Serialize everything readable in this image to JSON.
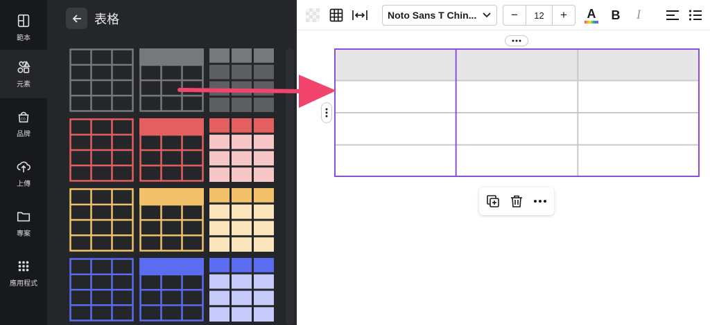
{
  "rail": {
    "items": [
      {
        "label": "範本",
        "icon": "template-icon"
      },
      {
        "label": "元素",
        "icon": "elements-icon"
      },
      {
        "label": "品牌",
        "icon": "brand-icon"
      },
      {
        "label": "上傳",
        "icon": "upload-icon"
      },
      {
        "label": "專案",
        "icon": "folder-icon"
      },
      {
        "label": "應用程式",
        "icon": "apps-icon"
      }
    ],
    "active": "元素"
  },
  "panel": {
    "title": "表格",
    "back_icon": "arrow-left-icon",
    "styles": [
      {
        "name": "gray",
        "color": "#77787c",
        "light": "#5e5f63"
      },
      {
        "name": "red",
        "color": "#e45f5f",
        "light": "#f7c6c6"
      },
      {
        "name": "yellow",
        "color": "#f2c26a",
        "light": "#fbe5bd"
      },
      {
        "name": "blue",
        "color": "#5b6cf0",
        "light": "#c6cbfb"
      }
    ]
  },
  "toolbar": {
    "font": "Noto Sans T Chin...",
    "font_size": "12",
    "decrease": "−",
    "increase": "+",
    "text_color_glyph": "A",
    "bold_glyph": "B",
    "italic_glyph": "I",
    "icons": [
      "transparency-icon",
      "table-grid-icon",
      "spacing-icon",
      "text-color-icon",
      "bold-icon",
      "italic-icon",
      "align-left-icon",
      "list-icon"
    ]
  },
  "canvas": {
    "rows": 4,
    "cols": 3,
    "header_fill": "#e6e6e6",
    "border_color": "#c9c9c9",
    "selection_color": "#8a4fd8"
  },
  "arrow_color": "#f2456e",
  "float_toolbar": {
    "icons": [
      "duplicate-icon",
      "trash-icon",
      "more-icon"
    ]
  }
}
